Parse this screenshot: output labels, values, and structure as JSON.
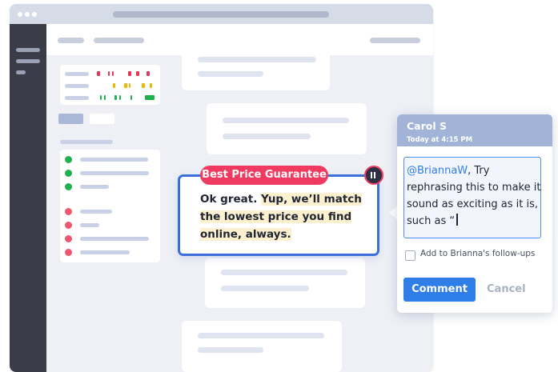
{
  "highlight": {
    "tag_label": "Best Price Guarantee",
    "message_plain": "Ok great. ",
    "message_marked": "Yup, we’ll match the lowest price you find online, always."
  },
  "comment_panel": {
    "author": "Carol S",
    "timestamp": "Today at 4:15 PM",
    "mention": "@BriannaW",
    "draft_text": ", Try rephrasing this to make it sound as exciting as it is, such as “",
    "checkbox_label": "Add to Brianna's follow-ups",
    "checkbox_checked": false,
    "comment_button": "Comment",
    "cancel_button": "Cancel"
  },
  "colors": {
    "accent_blue": "#3b6fd9",
    "tag_red": "#f03a5f",
    "comment_blue": "#2f7de6",
    "status_green": "#1fb14d",
    "status_red": "#f0566f",
    "bar_yellow": "#f2b705",
    "sidebar_dark": "#3a3d48",
    "panel_header": "#a1b4d7"
  },
  "icons": {
    "pause": "pause-icon",
    "window_controls": "window-dots-icon"
  }
}
